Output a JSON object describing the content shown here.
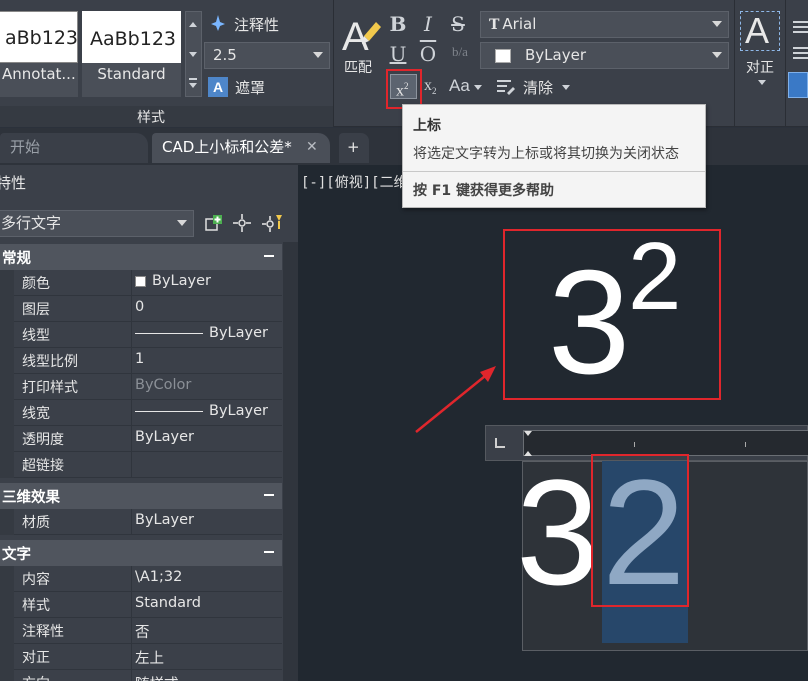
{
  "ribbon": {
    "styles_panel": {
      "swatch_1_text": "aBb123",
      "swatch_1_caption": "Annotat...",
      "swatch_2_text": "AaBb123",
      "swatch_2_caption": "Standard",
      "annotative_label": "注释性",
      "text_height_value": "2.5",
      "mask_label": "遮罩",
      "panel_title": "样式"
    },
    "formatting_panel": {
      "match_label": "匹配",
      "font_value": "Arial",
      "color_value": "ByLayer",
      "clear_label": "清除"
    },
    "justify_label": "对正"
  },
  "tooltip": {
    "title": "上标",
    "description": "将选定文字转为上标或将其切换为关闭状态",
    "help_prefix": "按 F1 键获得更多帮助"
  },
  "tabs": [
    {
      "label": "开始",
      "active": false
    },
    {
      "label": "CAD上小标和公差*",
      "active": true
    }
  ],
  "palette": {
    "title": "特性",
    "object_type": "多行文字",
    "sections": [
      {
        "title": "常规",
        "rows": [
          {
            "key": "颜色",
            "value": "ByLayer"
          },
          {
            "key": "图层",
            "value": "0"
          },
          {
            "key": "线型",
            "value": "ByLayer"
          },
          {
            "key": "线型比例",
            "value": "1"
          },
          {
            "key": "打印样式",
            "value": "ByColor"
          },
          {
            "key": "线宽",
            "value": "ByLayer"
          },
          {
            "key": "透明度",
            "value": "ByLayer"
          },
          {
            "key": "超链接",
            "value": ""
          }
        ]
      },
      {
        "title": "三维效果",
        "rows": [
          {
            "key": "材质",
            "value": "ByLayer"
          }
        ]
      },
      {
        "title": "文字",
        "rows": [
          {
            "key": "内容",
            "value": "\\A1;32"
          },
          {
            "key": "样式",
            "value": "Standard"
          },
          {
            "key": "注释性",
            "value": "否"
          },
          {
            "key": "对正",
            "value": "左上"
          },
          {
            "key": "方向",
            "value": "随样式"
          }
        ]
      }
    ]
  },
  "canvas": {
    "viewport_label": "[-][俯视][二维线框]",
    "result_base": "3",
    "result_superscript": "2",
    "editor_base": "3",
    "editor_selected": "2"
  },
  "colors": {
    "highlight_red": "#e0262c",
    "selection_blue": "#27476a",
    "arrow_red": "#e0262c"
  }
}
